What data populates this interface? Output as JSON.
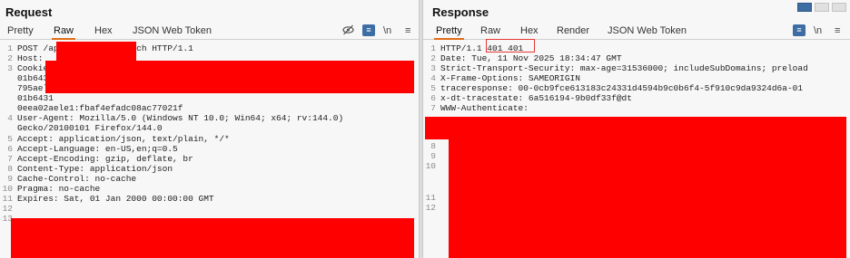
{
  "request": {
    "title": "Request",
    "tabs": [
      "Pretty",
      "Raw",
      "Hex",
      "JSON Web Token"
    ],
    "active_tab": "Raw",
    "controls": [
      "\\n",
      "≡"
    ],
    "lines": [
      {
        "n": "1",
        "text": "POST /api/dom/form/search HTTP/1.1"
      },
      {
        "n": "2",
        "text": "Host:"
      },
      {
        "n": "3",
        "text": "Cookie:"
      },
      {
        "n": "",
        "text": "01b6431"
      },
      {
        "n": "",
        "text": "795aela"
      },
      {
        "n": "",
        "text": "01b6431"
      },
      {
        "n": "",
        "text": "0eea02aele1:fbaf4efadc08ac77021f"
      },
      {
        "n": "4",
        "text": "User-Agent: Mozilla/5.0 (Windows NT 10.0; Win64; x64; rv:144.0)"
      },
      {
        "n": "",
        "text": "Gecko/20100101 Firefox/144.0"
      },
      {
        "n": "5",
        "text": "Accept: application/json, text/plain, */*"
      },
      {
        "n": "6",
        "text": "Accept-Language: en-US,en;q=0.5"
      },
      {
        "n": "7",
        "text": "Accept-Encoding: gzip, deflate, br"
      },
      {
        "n": "8",
        "text": "Content-Type: application/json"
      },
      {
        "n": "9",
        "text": "Cache-Control: no-cache"
      },
      {
        "n": "10",
        "text": "Pragma: no-cache"
      },
      {
        "n": "11",
        "text": "Expires: Sat, 01 Jan 2000 00:00:00 GMT"
      },
      {
        "n": "12",
        "text": ""
      },
      {
        "n": "13",
        "text": ""
      }
    ]
  },
  "response": {
    "title": "Response",
    "tabs": [
      "Pretty",
      "Raw",
      "Hex",
      "Render",
      "JSON Web Token"
    ],
    "active_tab": "Pretty",
    "controls": [
      "\\n",
      "≡"
    ],
    "status_highlight": "401 401",
    "lines": [
      {
        "n": "1",
        "text": "HTTP/1.1 401 401"
      },
      {
        "n": "2",
        "text": "Date: Tue, 11 Nov 2025 18:34:47 GMT"
      },
      {
        "n": "3",
        "text": "Strict-Transport-Security: max-age=31536000; includeSubDomains; preload"
      },
      {
        "n": "4",
        "text": "X-Frame-Options: SAMEORIGIN"
      },
      {
        "n": "5",
        "text": "traceresponse: 00-0cb9fce613183c24331d4594b9c0b6f4-5f910c9da9324d6a-01"
      },
      {
        "n": "6",
        "text": "x-dt-tracestate: 6a516194-9b0df33f@dt"
      },
      {
        "n": "7",
        "text": "WWW-Authenticate:"
      },
      {
        "n": "8",
        "text": ""
      },
      {
        "n": "9",
        "text": ""
      },
      {
        "n": "10",
        "text": ""
      },
      {
        "n": "11",
        "text": ""
      },
      {
        "n": "12",
        "text": ""
      }
    ]
  },
  "colors": {
    "accent": "#e06c17",
    "redaction": "#ff0000",
    "status_box": "#e53935",
    "badge": "#3d6da3"
  },
  "icons": [
    "eye-slash-icon",
    "wrap-badge-icon",
    "newline-icon",
    "menu-icon"
  ]
}
